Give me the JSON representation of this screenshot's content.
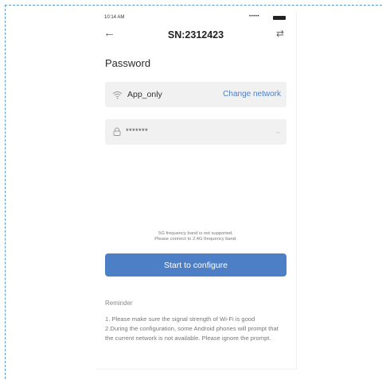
{
  "status_bar": {
    "time": "10:14 AM",
    "signal": "•••••"
  },
  "header": {
    "title": "SN:2312423",
    "back_icon": "arrow-left-icon",
    "switch_icon": "swap-icon"
  },
  "section": {
    "title": "Password"
  },
  "network": {
    "ssid": "App_only",
    "change_label": "Change network",
    "icon": "wifi-icon"
  },
  "password": {
    "value": "*******",
    "icon": "lock-icon",
    "toggle_icon": "eye-closed-icon"
  },
  "notice": {
    "line1": "5G frequency band is not supported.",
    "line2": "Please connect to 2.4G frequency band."
  },
  "configure_button": {
    "label": "Start to configure"
  },
  "reminder": {
    "heading": "Reminder",
    "item1": "1. Please make sure the signal strength of Wi-Fi is good",
    "item2": "2.During the configuration, some Android phones will prompt that the current network is not available. Please ignore the prompt."
  },
  "colors": {
    "accent": "#4d7fc6",
    "link": "#4c80c8",
    "field_bg": "#f1f1f1"
  }
}
